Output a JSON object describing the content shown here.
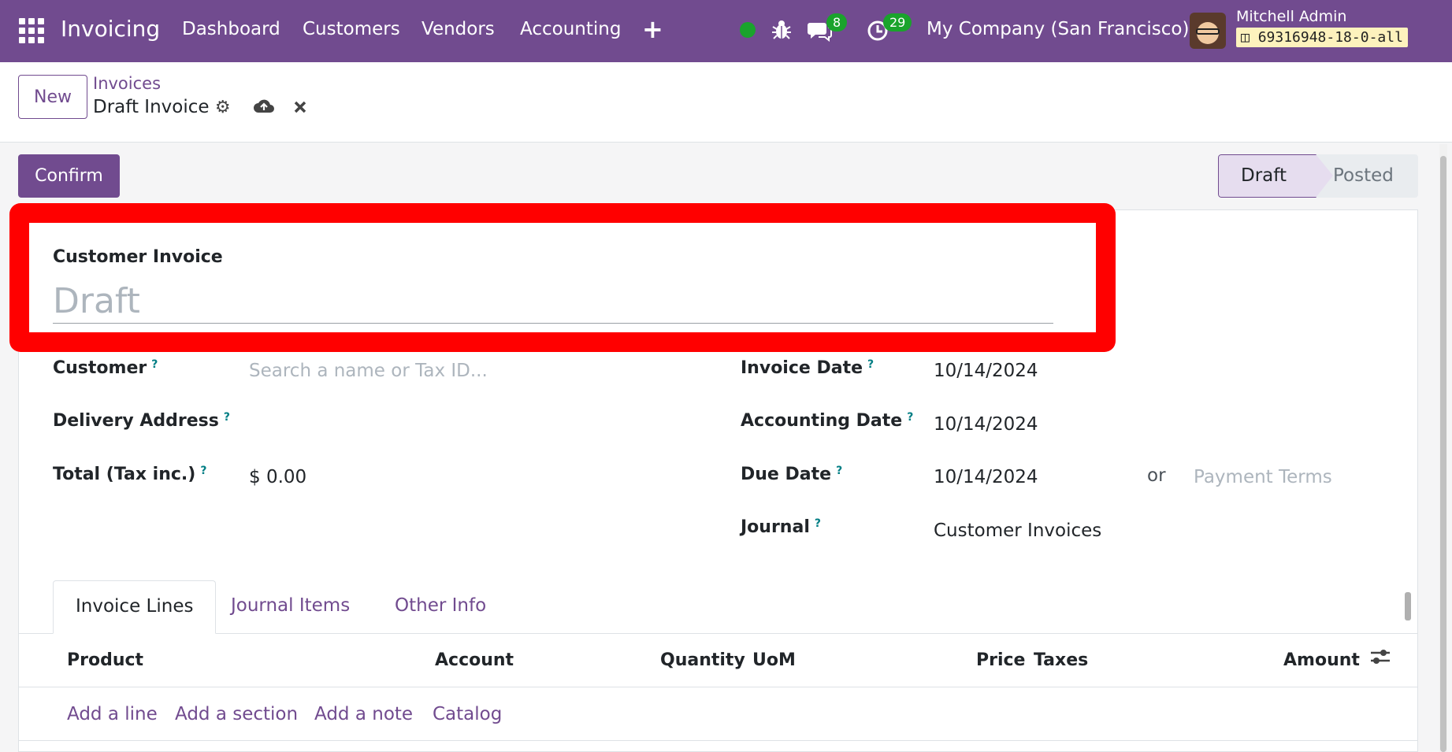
{
  "topbar": {
    "brand": "Invoicing",
    "menu": [
      "Dashboard",
      "Customers",
      "Vendors",
      "Accounting"
    ],
    "plus_icon": "+",
    "chat_count": "8",
    "activity_count": "29",
    "company": "My Company (San Francisco)",
    "user": "Mitchell Admin",
    "database": "69316948-18-0-all",
    "icons": [
      "apps-grid-icon",
      "status-online-icon",
      "bug-icon",
      "chat-icon",
      "activity-clock-icon",
      "database-icon"
    ]
  },
  "control": {
    "new_label": "New",
    "breadcrumb_parent": "Invoices",
    "breadcrumb_current": "Draft Invoice",
    "icons": [
      "gear-icon",
      "cloud-upload-icon",
      "close-icon"
    ]
  },
  "actions": {
    "confirm_label": "Confirm"
  },
  "status": {
    "draft": "Draft",
    "posted": "Posted",
    "current": "Draft"
  },
  "form": {
    "type_label": "Customer Invoice",
    "title_placeholder": "Draft",
    "help_mark": "?",
    "customer_label": "Customer",
    "customer_placeholder": "Search a name or Tax ID...",
    "delivery_label": "Delivery Address",
    "total_label": "Total (Tax inc.)",
    "total_value": "$ 0.00",
    "invoice_date_label": "Invoice Date",
    "invoice_date": "10/14/2024",
    "accounting_date_label": "Accounting Date",
    "accounting_date": "10/14/2024",
    "due_date_label": "Due Date",
    "due_date": "10/14/2024",
    "or_label": "or",
    "payment_terms_placeholder": "Payment Terms",
    "journal_label": "Journal",
    "journal_value": "Customer Invoices"
  },
  "tabs": {
    "invoice_lines": "Invoice Lines",
    "journal_items": "Journal Items",
    "other_info": "Other Info",
    "active": "Invoice Lines"
  },
  "lines_table": {
    "columns": [
      "Product",
      "Account",
      "Quantity",
      "UoM",
      "Price",
      "Taxes",
      "Amount"
    ],
    "add_line": "Add a line",
    "add_section": "Add a section",
    "add_note": "Add a note",
    "catalog": "Catalog"
  },
  "colors": {
    "brand": "#714b8f",
    "highlight": "#ff0000",
    "badge_green": "#1aa32c"
  }
}
